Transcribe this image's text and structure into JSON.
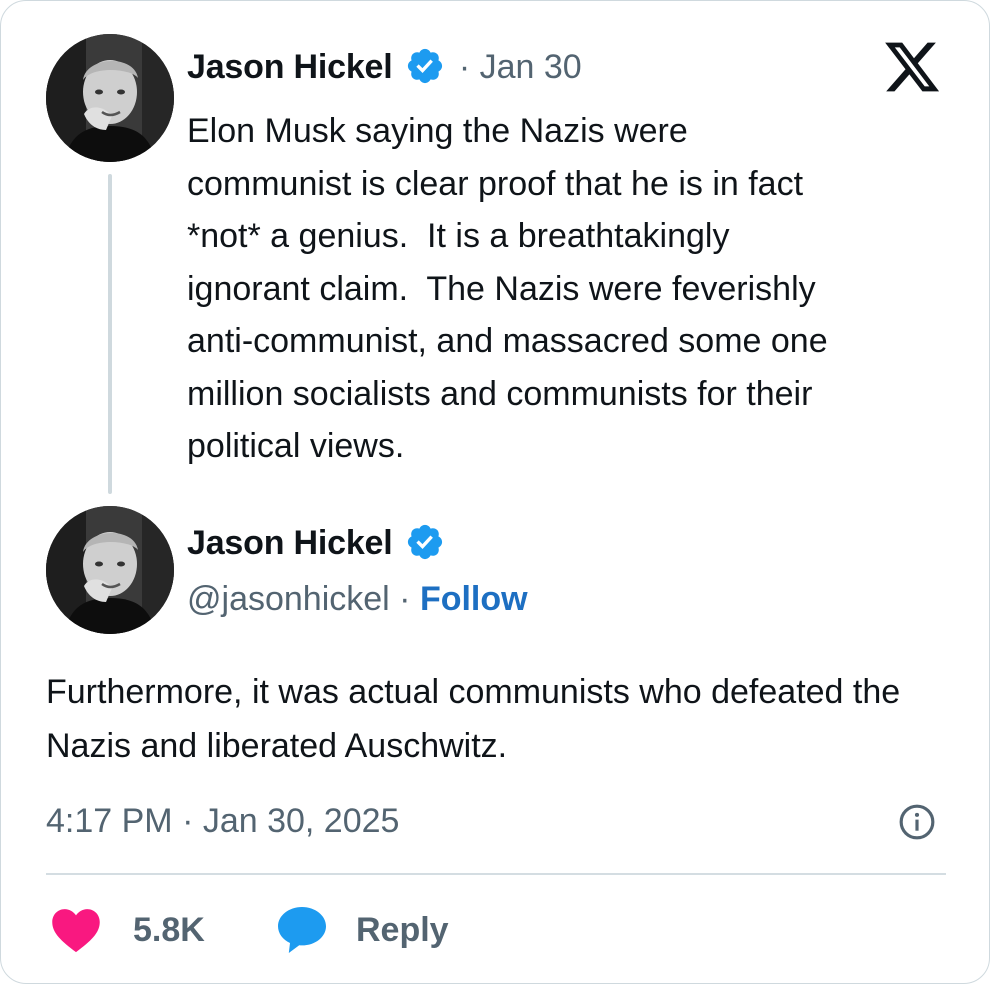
{
  "reply_tweet": {
    "author_name": "Jason Hickel",
    "date": "Jan 30",
    "text": "Elon Musk saying the Nazis were\ncommunist is clear proof that he is in fact\n*not* a genius.  It is a breathtakingly\nignorant claim.  The Nazis were feverishly\nanti-communist, and massacred some one\nmillion socialists and communists for their\npolitical views."
  },
  "main_tweet": {
    "author_name": "Jason Hickel",
    "handle": "@jasonhickel",
    "follow_label": "Follow",
    "text": "Furthermore, it was actual communists who defeated the Nazis and liberated Auschwitz.",
    "timestamp": "4:17 PM · Jan 30, 2025"
  },
  "actions": {
    "like_count": "5.8K",
    "reply_label": "Reply"
  },
  "colors": {
    "like": "#f91880",
    "reply": "#1d9bf0",
    "verified": "#1d9bf0",
    "follow": "#1d6fc2"
  },
  "icons": {
    "logo": "x-logo-icon",
    "verified": "verified-badge-icon",
    "info": "info-icon",
    "like": "heart-icon",
    "reply": "speech-bubble-icon"
  }
}
